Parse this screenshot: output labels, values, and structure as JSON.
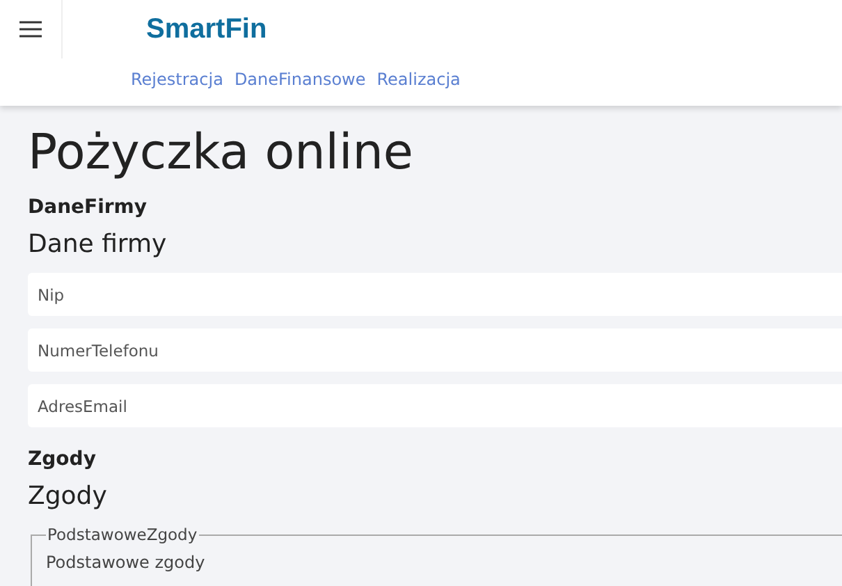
{
  "header": {
    "logo": "SmartFin",
    "nav": [
      {
        "label": "Rejestracja"
      },
      {
        "label": "DaneFinansowe"
      },
      {
        "label": "Realizacja"
      }
    ]
  },
  "title": "Pożyczka online",
  "sections": [
    {
      "step": "DaneFirmy",
      "heading": "Dane firmy",
      "fields": [
        {
          "placeholder": "Nip"
        },
        {
          "placeholder": "NumerTelefonu"
        },
        {
          "placeholder": "AdresEmail"
        }
      ]
    },
    {
      "step": "Zgody",
      "heading": "Zgody",
      "fieldset": {
        "legend": "PodstawoweZgody",
        "caption": "Podstawowe zgody"
      }
    }
  ]
}
